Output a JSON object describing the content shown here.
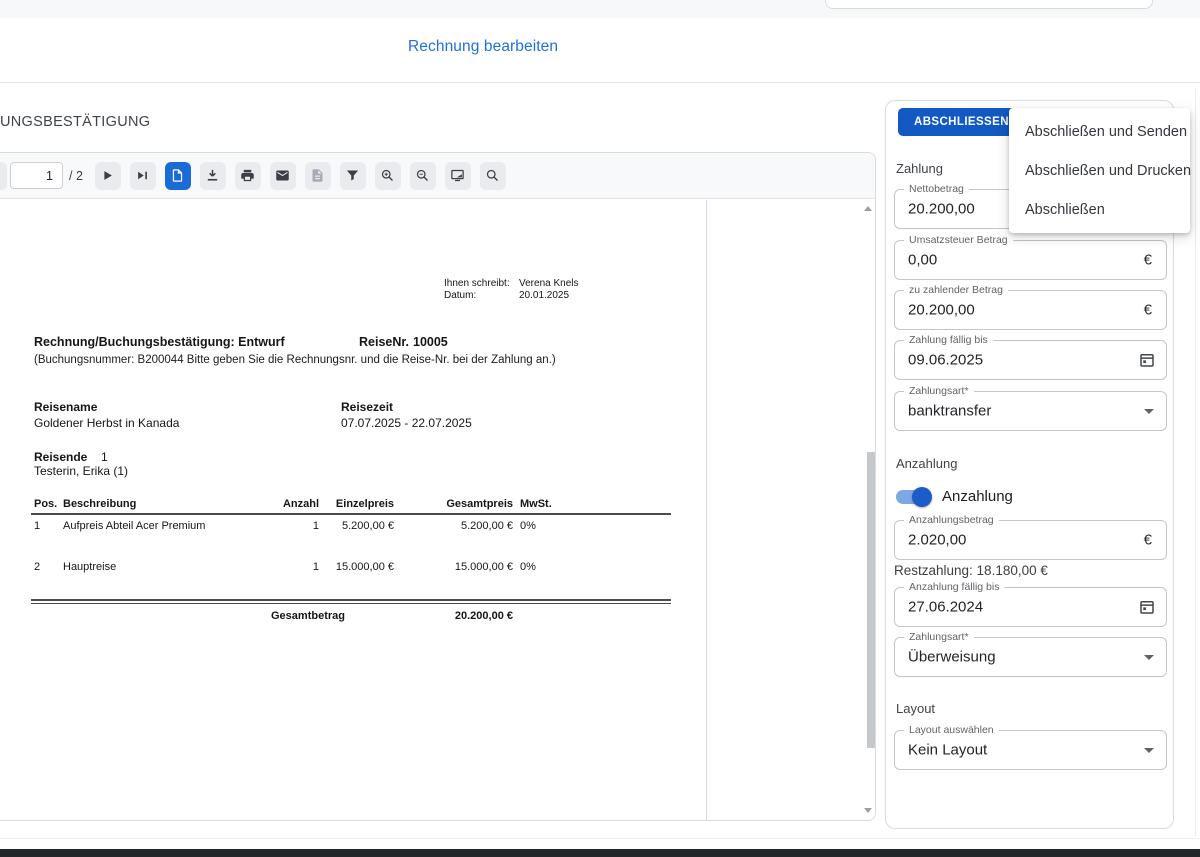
{
  "header": {
    "tab_label": "Rechnung bearbeiten",
    "page_title": "UNGSBESTÄTIGUNG"
  },
  "toolbar": {
    "page_input_value": "1",
    "page_count_label": "/ 2"
  },
  "document": {
    "from_label": "Ihnen schreibt:",
    "from_value": "Verena Knels",
    "date_label": "Datum:",
    "date_value": "20.01.2025",
    "title": "Rechnung/Buchungsbestätigung: Entwurf",
    "trip_number_label": "ReiseNr.",
    "trip_number_value": "10005",
    "booking_note": "(Buchungsnummer: B200044 Bitte geben Sie die Rechnungsnr. und die Reise-Nr. bei der Zahlung an.)",
    "trip_name_label": "Reisename",
    "trip_name_value": "Goldener Herbst in Kanada",
    "trip_period_label": "Reisezeit",
    "trip_period_value": "07.07.2025  - 22.07.2025",
    "travelers_label": "Reisende",
    "travelers_count": "1",
    "travelers_value": "Testerin, Erika (1)",
    "items_table": {
      "headers": {
        "pos": "Pos.",
        "description": "Beschreibung",
        "quantity": "Anzahl",
        "unit_price": "Einzelpreis",
        "total_price": "Gesamtpreis",
        "vat": "MwSt."
      },
      "rows": [
        {
          "pos": "1",
          "description": "Aufpreis Abteil Acer Premium",
          "quantity": "1",
          "unit_price": "5.200,00 €",
          "total_price": "5.200,00 €",
          "vat": "0%"
        },
        {
          "pos": "2",
          "description": "Hauptreise",
          "quantity": "1",
          "unit_price": "15.000,00 €",
          "total_price": "15.000,00 €",
          "vat": "0%"
        }
      ],
      "total_label": "Gesamtbetrag",
      "total_value": "20.200,00 €"
    }
  },
  "sidebar": {
    "finish_button_label": "ABSCHLIESSEN",
    "menu": {
      "items": [
        "Abschließen und Senden",
        "Abschließen und Drucken",
        "Abschließen"
      ]
    },
    "payment": {
      "section_label": "Zahlung",
      "net_amount": {
        "label": "Nettobetrag",
        "value": "20.200,00",
        "suffix": "€"
      },
      "vat_amount": {
        "label": "Umsatzsteuer Betrag",
        "value": "0,00",
        "suffix": "€"
      },
      "payable_amount": {
        "label": "zu zahlender Betrag",
        "value": "20.200,00",
        "suffix": "€"
      },
      "due_date": {
        "label": "Zahlung fällig bis",
        "value": "09.06.2025"
      },
      "payment_method": {
        "label": "Zahlungsart*",
        "value": "banktransfer"
      }
    },
    "deposit": {
      "section_label": "Anzahlung",
      "toggle_label": "Anzahlung",
      "toggle_on": true,
      "deposit_amount": {
        "label": "Anzahlungsbetrag",
        "value": "2.020,00",
        "suffix": "€"
      },
      "remainder_text": "Restzahlung: 18.180,00 €",
      "due_date": {
        "label": "Anzahlung fällig bis",
        "value": "27.06.2024"
      },
      "payment_method": {
        "label": "Zahlungsart*",
        "value": "Überweisung"
      }
    },
    "layout": {
      "section_label": "Layout",
      "layout_select": {
        "label": "Layout auswählen",
        "value": "Kein Layout"
      }
    }
  },
  "colors": {
    "accent_blue": "#1a6bd8",
    "button_blue": "#1259c3",
    "dark_footer": "#25282b"
  }
}
